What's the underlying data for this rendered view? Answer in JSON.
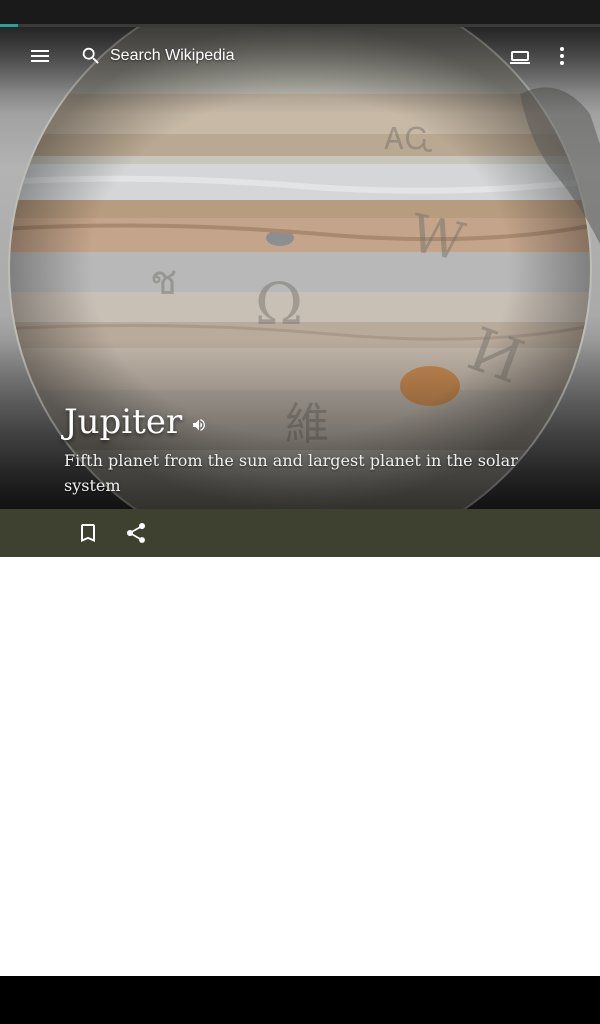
{
  "page_progress": 0.03,
  "colors": {
    "accent": "#2aa198",
    "action_bar": "#3f4130",
    "status_bar": "#1a1a1a",
    "nav_bar": "#000000"
  },
  "toolbar": {
    "menu_icon": "hamburger-menu-icon",
    "search_icon": "magnifier-icon",
    "search_placeholder": "Search Wikipedia",
    "tabs_icon": "tabs-icon",
    "overflow_icon": "vertical-dots-icon"
  },
  "article": {
    "title": "Jupiter",
    "description": "Fifth planet from the sun and largest planet in the solar system",
    "audio_icon": "speaker-icon"
  },
  "actions": {
    "save_icon": "bookmark-outline-icon",
    "share_icon": "share-icon"
  }
}
